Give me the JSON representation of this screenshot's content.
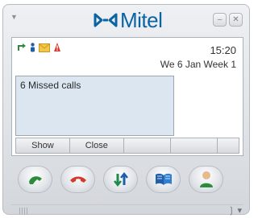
{
  "titlebar": {
    "logo_text": "Mitel",
    "menu_icon": "dropdown-arrow-icon",
    "minimize_label": "–",
    "close_label": "✕"
  },
  "screen": {
    "status_icons": [
      "forward-call-icon",
      "contacts-icon",
      "voicemail-icon",
      "alert-icon"
    ],
    "time": "15:20",
    "date": "We 6 Jan Week 1",
    "message": "6 Missed calls"
  },
  "softkeys": [
    "Show",
    "Close",
    "",
    "",
    ""
  ],
  "phone_buttons": [
    {
      "name": "answer-call-button",
      "icon": "phone-pickup-icon",
      "color": "#2e8b3a"
    },
    {
      "name": "hangup-button",
      "icon": "phone-hangup-icon",
      "color": "#d43b2b"
    },
    {
      "name": "transfer-button",
      "icon": "transfer-icon",
      "color": "#1f8a4a"
    },
    {
      "name": "phonebook-button",
      "icon": "book-icon",
      "color": "#1f5fa8"
    },
    {
      "name": "contact-button",
      "icon": "person-icon",
      "color": "#2e8b3a"
    }
  ],
  "statusbar": {
    "right_text": "❳ ▾"
  },
  "colors": {
    "brand": "#0a63a3",
    "screen_bg": "#ffffff",
    "message_bg": "#dbe6f1"
  }
}
